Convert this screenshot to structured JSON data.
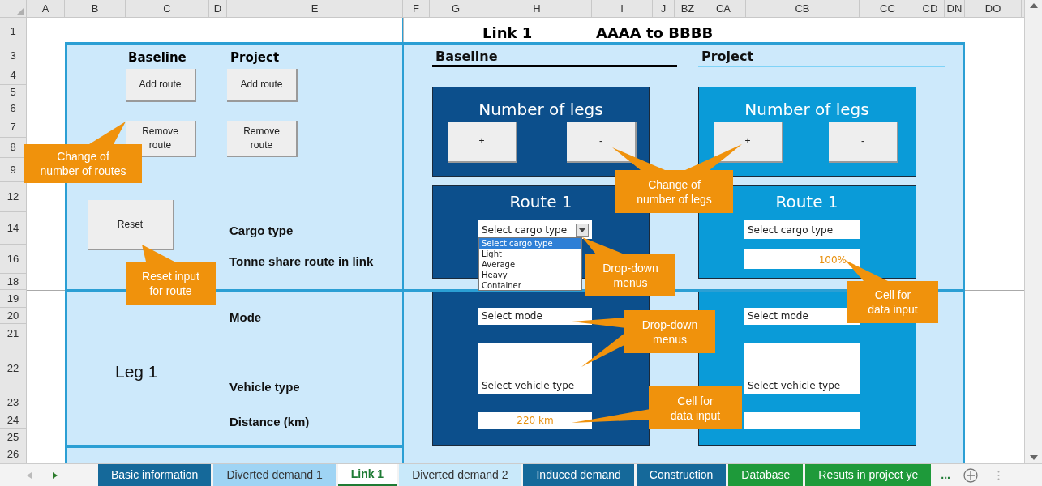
{
  "column_headers": [
    "A",
    "B",
    "C",
    "D",
    "E",
    "F",
    "G",
    "H",
    "I",
    "J",
    "BZ",
    "CA",
    "CB",
    "CC",
    "CD",
    "DN",
    "DO"
  ],
  "row_headers": [
    "1",
    "3",
    "4",
    "5",
    "6",
    "7",
    "8",
    "9",
    "12",
    "14",
    "16",
    "18",
    "19",
    "20",
    "21",
    "22",
    "23",
    "24",
    "25",
    "26"
  ],
  "sheet_title": {
    "link": "Link 1",
    "route": "AAAA to BBBB"
  },
  "left_panel": {
    "baseline_heading": "Baseline",
    "project_heading": "Project",
    "baseline_buttons": [
      "Add route",
      "Remove route"
    ],
    "project_buttons": [
      "Add route",
      "Remove route"
    ],
    "reset_button": "Reset",
    "field_labels": [
      "Cargo type",
      "Tonne share route in link",
      "Mode",
      "Vehicle type",
      "Distance (km)"
    ],
    "leg_label": "Leg 1"
  },
  "scenarios": [
    {
      "kind": "baseline",
      "heading": "Baseline",
      "legs_title": "Number of legs",
      "leg_buttons": [
        "+",
        "-"
      ],
      "route_title": "Route 1",
      "cargo_type": "Select cargo type",
      "dropdown_open": true,
      "cargo_options": [
        {
          "label": "Select cargo type",
          "selected": true
        },
        {
          "label": "Light",
          "selected": false
        },
        {
          "label": "Average",
          "selected": false
        },
        {
          "label": "Heavy",
          "selected": false
        },
        {
          "label": "Container",
          "selected": false
        }
      ],
      "mode": "Select mode",
      "vehicle_type": "Select vehicle type",
      "distance": "220 km"
    },
    {
      "kind": "project",
      "heading": "Project",
      "legs_title": "Number of legs",
      "leg_buttons": [
        "+",
        "-"
      ],
      "route_title": "Route 1",
      "cargo_type": "Select cargo type",
      "dropdown_open": false,
      "tonne_share": "100%",
      "mode": "Select mode",
      "vehicle_type": "Select vehicle type"
    }
  ],
  "callouts": [
    {
      "text": "Change of\nnumber of routes"
    },
    {
      "text": "Reset input\nfor route"
    },
    {
      "text": "Change of\nnumber of legs"
    },
    {
      "text": "Drop-down\nmenus"
    },
    {
      "text": "Drop-down\nmenus"
    },
    {
      "text": "Cell for\ndata input"
    },
    {
      "text": "Cell for\ndata input"
    }
  ],
  "sheet_tabs": [
    {
      "label": "Basic information",
      "color": "#15699a",
      "selected": false
    },
    {
      "label": "Diverted demand 1",
      "color": "#9fd4f4",
      "selected": false
    },
    {
      "label": "Link 1",
      "color": "#ffffff",
      "selected": true
    },
    {
      "label": "Diverted demand 2",
      "color": "#c9e9fa",
      "selected": false
    },
    {
      "label": "Induced demand",
      "color": "#15699a",
      "selected": false
    },
    {
      "label": "Construction",
      "color": "#15699a",
      "selected": false
    },
    {
      "label": "Database",
      "color": "#1e9a3a",
      "selected": false
    },
    {
      "label": "Resuts in project ye",
      "color": "#1e9a3a",
      "selected": false
    }
  ],
  "more_tabs": "..."
}
